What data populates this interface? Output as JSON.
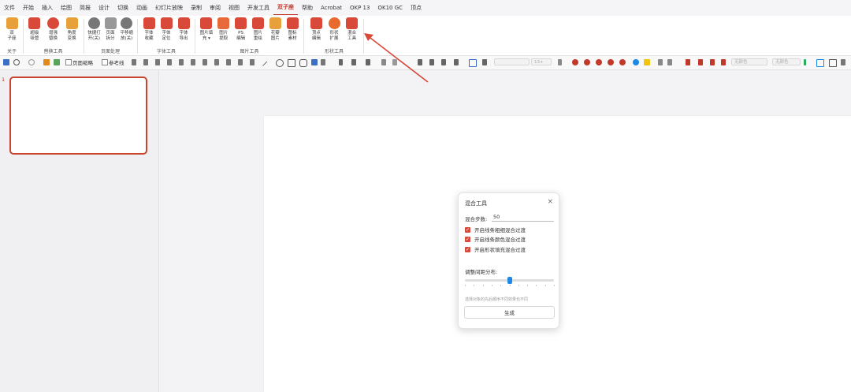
{
  "menu": {
    "items": [
      "文件",
      "开始",
      "插入",
      "绘图",
      "简报",
      "设计",
      "切换",
      "动画",
      "幻灯片放映",
      "录制",
      "审阅",
      "视图",
      "开发工具",
      "双子座",
      "帮助",
      "Acrobat",
      "OKP 13",
      "OK10 GC",
      "顶点"
    ],
    "active_index": 13
  },
  "ribbon": {
    "groups": [
      {
        "name": "关于",
        "buttons": [
          {
            "label": "双\n子座",
            "icon": "hourglass-icon"
          }
        ]
      },
      {
        "name": "替换工具",
        "buttons": [
          {
            "label": "超级\n吸管",
            "icon": "eyedropper-icon"
          },
          {
            "label": "增强\n替换",
            "icon": "magnifier-icon"
          },
          {
            "label": "角度\n变换",
            "icon": "angle-icon"
          }
        ]
      },
      {
        "name": "页面处理",
        "buttons": [
          {
            "label": "快捷打\n开(关)",
            "icon": "power-icon"
          },
          {
            "label": "页面\n拆分",
            "icon": "page-split-icon"
          },
          {
            "label": "平移缩\n放(关)",
            "icon": "pan-zoom-icon"
          }
        ]
      },
      {
        "name": "字体工具",
        "buttons": [
          {
            "label": "字体\n收藏",
            "icon": "font-collect-icon"
          },
          {
            "label": "字体\n定位",
            "icon": "font-locate-icon"
          },
          {
            "label": "字体\n导出",
            "icon": "font-export-icon"
          }
        ]
      },
      {
        "name": "图片工具",
        "buttons": [
          {
            "label": "图片填\n充 ▾",
            "icon": "image-fill-icon"
          },
          {
            "label": "图片\n提取",
            "icon": "image-extract-icon"
          },
          {
            "label": "PS\n编辑",
            "icon": "ps-icon"
          },
          {
            "label": "图片\n重绘",
            "icon": "image-redraw-icon"
          },
          {
            "label": "花瓣\n图片",
            "icon": "petal-icon"
          },
          {
            "label": "图标\n素材",
            "icon": "icon-material-icon"
          }
        ]
      },
      {
        "name": "形状工具",
        "buttons": [
          {
            "label": "顶点\n编辑",
            "icon": "vertex-edit-icon"
          },
          {
            "label": "形状\n扩展",
            "icon": "shape-extend-icon"
          },
          {
            "label": "混合\n工具",
            "icon": "blend-tool-icon"
          }
        ]
      }
    ]
  },
  "toolbar2": {
    "page_guide_label": "页面缩略",
    "reference_label": "参考线",
    "font_size_placeholder": "13+",
    "box_a": "无颜色",
    "box_b": "无颜色"
  },
  "thumbs": {
    "slide_number": "1"
  },
  "dialog": {
    "title": "混合工具",
    "close_glyph": "×",
    "steps_label": "混合步数:",
    "steps_value": "50",
    "options": [
      {
        "label": "开启线条粗细混合过渡",
        "checked": true
      },
      {
        "label": "开启线条颜色混合过渡",
        "checked": true
      },
      {
        "label": "开启形状填充混合过渡",
        "checked": true
      }
    ],
    "distribution_label": "调整间距分布:",
    "slider_value": 0.5,
    "hint": "选择对象的先后顺序不同效果也不同",
    "generate_label": "生成"
  },
  "colors": {
    "accent": "#d9493a",
    "slider": "#1e88e5",
    "arrow": "#d9493a"
  }
}
